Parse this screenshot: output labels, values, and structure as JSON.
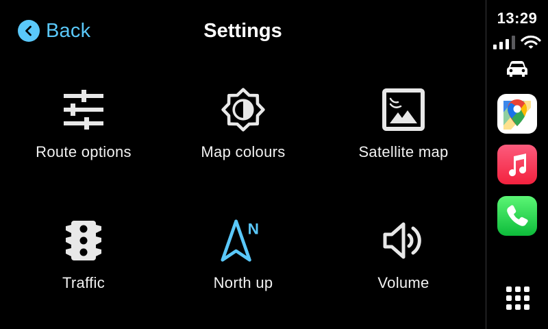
{
  "header": {
    "back_label": "Back",
    "title": "Settings"
  },
  "tiles": [
    {
      "label": "Route options",
      "icon": "sliders-icon"
    },
    {
      "label": "Map colours",
      "icon": "brightness-icon"
    },
    {
      "label": "Satellite map",
      "icon": "picture-icon"
    },
    {
      "label": "Traffic",
      "icon": "traffic-light-icon"
    },
    {
      "label": "North up",
      "icon": "north-arrow-icon"
    },
    {
      "label": "Volume",
      "icon": "speaker-icon"
    }
  ],
  "status": {
    "time": "13:29"
  },
  "dock": {
    "apps": [
      "google-maps-icon",
      "music-icon",
      "phone-icon"
    ]
  },
  "colors": {
    "accent": "#5ac8fa",
    "background": "#000000",
    "icon": "#e8e8e8"
  }
}
